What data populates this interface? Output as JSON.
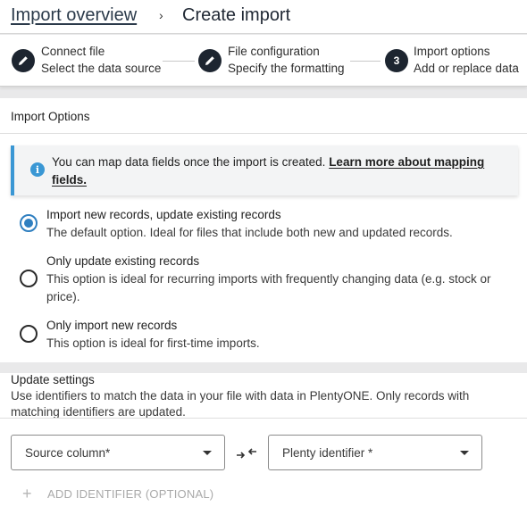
{
  "breadcrumb": {
    "parent": "Import overview",
    "separator": "›",
    "current": "Create import"
  },
  "steps": [
    {
      "title": "Connect file",
      "subtitle": "Select the data source",
      "state": "done",
      "icon": "pencil-icon"
    },
    {
      "title": "File configuration",
      "subtitle": "Specify the formatting",
      "state": "done",
      "icon": "pencil-icon"
    },
    {
      "number": "3",
      "title": "Import options",
      "subtitle": "Add or replace data",
      "state": "current"
    }
  ],
  "options": {
    "title": "Import Options",
    "info": {
      "text": "You can map data fields once the import is created. ",
      "link": "Learn more about mapping fields."
    },
    "choices": [
      {
        "title": "Import new records, update existing records",
        "description": "The default option. Ideal for files that include both new and updated records.",
        "selected": true
      },
      {
        "title": "Only update existing records",
        "description": "This option is ideal for recurring imports with frequently changing data (e.g. stock or price).",
        "selected": false
      },
      {
        "title": "Only import new records",
        "description": "This option is ideal for first-time imports.",
        "selected": false
      }
    ]
  },
  "update_settings": {
    "title": "Update settings",
    "description": "Use identifiers to match the data in your file with data in PlentyONE. Only records with matching identifiers are updated.",
    "source_select": "Source column*",
    "target_select": "Plenty identifier *",
    "add_identifier": "ADD IDENTIFIER (OPTIONAL)",
    "add_icon": "+"
  },
  "colors": {
    "accent": "#2f7fc0",
    "info_blue": "#3a97d4",
    "step_dark": "#1d2530"
  }
}
